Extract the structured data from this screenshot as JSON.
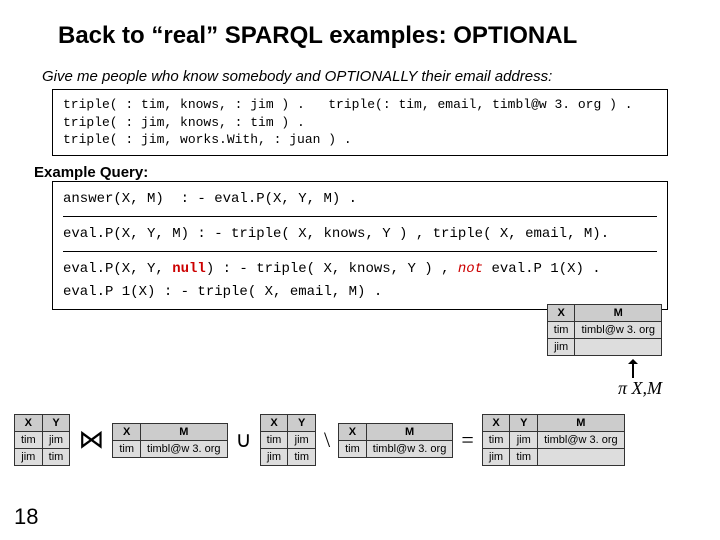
{
  "title": "Back to “real” SPARQL examples: OPTIONAL",
  "subtitle": "Give me people who know somebody and OPTIONALLY their email address:",
  "dataBox": "triple( : tim, knows, : jim ) .   triple(: tim, email, timbl@w 3. org ) .\ntriple( : jim, knows, : tim ) .\ntriple( : jim, works.With, : juan ) .",
  "exampleQueryLabel": "Example Query:",
  "q1": "answer(X, M)  : - eval.P(X, Y, M) .",
  "q2": "eval.P(X, Y, M) : - triple( X, knows, Y ) , triple( X, email, M).",
  "q3a": "eval.P(X, Y, ",
  "q3null": "null",
  "q3b": ") : - triple( X, knows, Y ) , ",
  "q3not": "not",
  "q3c": " eval.P 1(X) .",
  "q4": "eval.P 1(X) : - triple( X, email, M) .",
  "resultXM": {
    "headers": [
      "X",
      "M"
    ],
    "rows": [
      [
        "tim",
        "timbl@w 3. org"
      ],
      [
        "jim",
        ""
      ]
    ]
  },
  "projLabel": "π X,M",
  "tables": {
    "xy1": {
      "headers": [
        "X",
        "Y"
      ],
      "rows": [
        [
          "tim",
          "jim"
        ],
        [
          "jim",
          "tim"
        ]
      ]
    },
    "xm_small": {
      "headers": [
        "X",
        "M"
      ],
      "rows": [
        [
          "tim",
          "timbl@w 3. org"
        ]
      ]
    },
    "xy2": {
      "headers": [
        "X",
        "Y"
      ],
      "rows": [
        [
          "tim",
          "jim"
        ],
        [
          "jim",
          "tim"
        ]
      ]
    },
    "xm_small2": {
      "headers": [
        "X",
        "M"
      ],
      "rows": [
        [
          "tim",
          "timbl@w 3. org"
        ]
      ]
    },
    "xym": {
      "headers": [
        "X",
        "Y",
        "M"
      ],
      "rows": [
        [
          "tim",
          "jim",
          "timbl@w 3. org"
        ],
        [
          "jim",
          "tim",
          ""
        ]
      ]
    }
  },
  "ops": {
    "join": "⋈",
    "union": "∪",
    "diff": "\\",
    "eq": "="
  },
  "slideNumber": "18"
}
